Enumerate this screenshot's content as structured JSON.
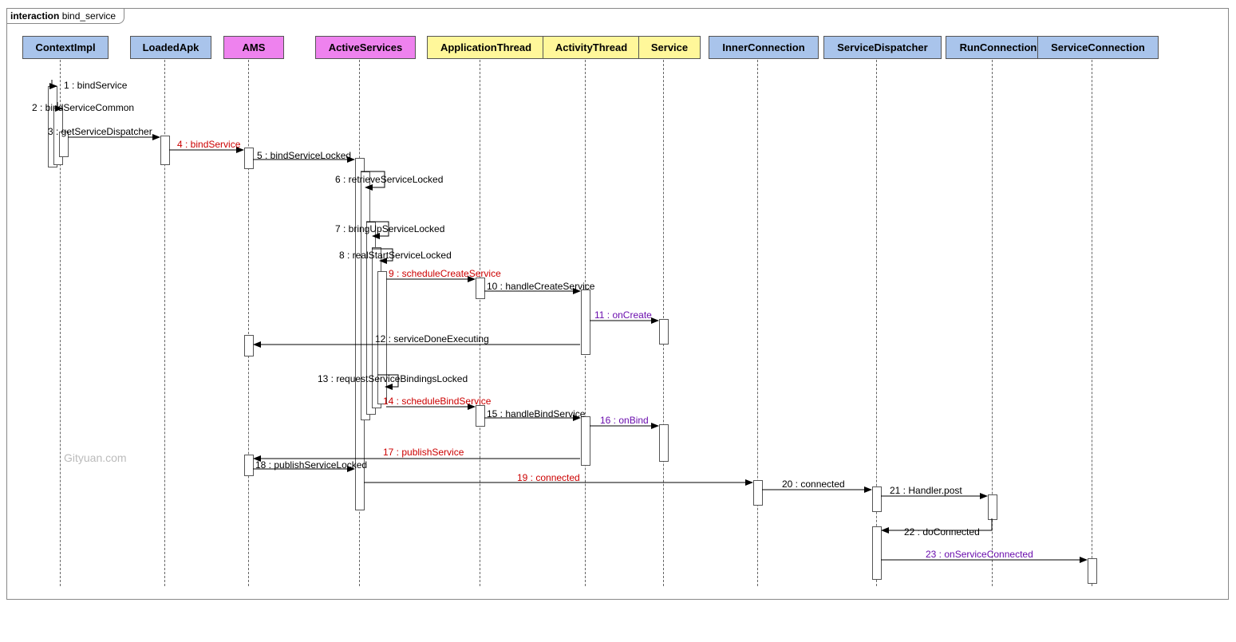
{
  "frame": {
    "label_bold": "interaction",
    "label_title": "bind_service"
  },
  "participants": {
    "ContextImpl": "ContextImpl",
    "LoadedApk": "LoadedApk",
    "AMS": "AMS",
    "ActiveServices": "ActiveServices",
    "ApplicationThread": "ApplicationThread",
    "ActivityThread": "ActivityThread",
    "Service": "Service",
    "InnerConnection": "InnerConnection",
    "ServiceDispatcher": "ServiceDispatcher",
    "RunConnection": "RunConnection",
    "ServiceConnection": "ServiceConnection"
  },
  "messages": {
    "m1": "1 : bindService",
    "m2": "2 : bindServiceCommon",
    "m3": "3 : getServiceDispatcher",
    "m4": "4 : bindService",
    "m5": "5 : bindServiceLocked",
    "m6": "6 : retrieveServiceLocked",
    "m7": "7 : bringUpServiceLocked",
    "m8": "8 : realStartServiceLocked",
    "m9": "9 : scheduleCreateService",
    "m10": "10 : handleCreateService",
    "m11": "11 : onCreate",
    "m12": "12 : serviceDoneExecuting",
    "m13": "13 : requestServiceBindingsLocked",
    "m14": "14 : scheduleBindService",
    "m15": "15 : handleBindService",
    "m16": "16 : onBind",
    "m17": "17 : publishService",
    "m18": "18 : publishServiceLocked",
    "m19": "19 : connected",
    "m20": "20 : connected",
    "m21": "21 : Handler.post",
    "m22": "22 : doConnected",
    "m23": "23 : onServiceConnected"
  },
  "watermark": "Gityuan.com",
  "chart_data": {
    "type": "sequence_diagram",
    "title": "interaction bind_service",
    "participants": [
      {
        "name": "ContextImpl",
        "color": "blue"
      },
      {
        "name": "LoadedApk",
        "color": "blue"
      },
      {
        "name": "AMS",
        "color": "magenta"
      },
      {
        "name": "ActiveServices",
        "color": "magenta"
      },
      {
        "name": "ApplicationThread",
        "color": "yellow"
      },
      {
        "name": "ActivityThread",
        "color": "yellow"
      },
      {
        "name": "Service",
        "color": "yellow"
      },
      {
        "name": "InnerConnection",
        "color": "blue"
      },
      {
        "name": "ServiceDispatcher",
        "color": "blue"
      },
      {
        "name": "RunConnection",
        "color": "blue"
      },
      {
        "name": "ServiceConnection",
        "color": "blue"
      }
    ],
    "messages": [
      {
        "n": 1,
        "from": "ContextImpl",
        "to": "ContextImpl",
        "label": "bindService"
      },
      {
        "n": 2,
        "from": "ContextImpl",
        "to": "ContextImpl",
        "label": "bindServiceCommon"
      },
      {
        "n": 3,
        "from": "ContextImpl",
        "to": "LoadedApk",
        "label": "getServiceDispatcher"
      },
      {
        "n": 4,
        "from": "LoadedApk",
        "to": "AMS",
        "label": "bindService",
        "emph": "red"
      },
      {
        "n": 5,
        "from": "AMS",
        "to": "ActiveServices",
        "label": "bindServiceLocked"
      },
      {
        "n": 6,
        "from": "ActiveServices",
        "to": "ActiveServices",
        "label": "retrieveServiceLocked"
      },
      {
        "n": 7,
        "from": "ActiveServices",
        "to": "ActiveServices",
        "label": "bringUpServiceLocked"
      },
      {
        "n": 8,
        "from": "ActiveServices",
        "to": "ActiveServices",
        "label": "realStartServiceLocked"
      },
      {
        "n": 9,
        "from": "ActiveServices",
        "to": "ApplicationThread",
        "label": "scheduleCreateService",
        "emph": "red"
      },
      {
        "n": 10,
        "from": "ApplicationThread",
        "to": "ActivityThread",
        "label": "handleCreateService"
      },
      {
        "n": 11,
        "from": "ActivityThread",
        "to": "Service",
        "label": "onCreate",
        "emph": "purple"
      },
      {
        "n": 12,
        "from": "ActivityThread",
        "to": "AMS",
        "label": "serviceDoneExecuting"
      },
      {
        "n": 13,
        "from": "ActiveServices",
        "to": "ActiveServices",
        "label": "requestServiceBindingsLocked"
      },
      {
        "n": 14,
        "from": "ActiveServices",
        "to": "ApplicationThread",
        "label": "scheduleBindService",
        "emph": "red"
      },
      {
        "n": 15,
        "from": "ApplicationThread",
        "to": "ActivityThread",
        "label": "handleBindService"
      },
      {
        "n": 16,
        "from": "ActivityThread",
        "to": "Service",
        "label": "onBind",
        "emph": "purple"
      },
      {
        "n": 17,
        "from": "ActivityThread",
        "to": "AMS",
        "label": "publishService",
        "emph": "red"
      },
      {
        "n": 18,
        "from": "AMS",
        "to": "ActiveServices",
        "label": "publishServiceLocked"
      },
      {
        "n": 19,
        "from": "ActiveServices",
        "to": "InnerConnection",
        "label": "connected",
        "emph": "red"
      },
      {
        "n": 20,
        "from": "InnerConnection",
        "to": "ServiceDispatcher",
        "label": "connected"
      },
      {
        "n": 21,
        "from": "ServiceDispatcher",
        "to": "RunConnection",
        "label": "Handler.post"
      },
      {
        "n": 22,
        "from": "RunConnection",
        "to": "ServiceDispatcher",
        "label": "doConnected"
      },
      {
        "n": 23,
        "from": "ServiceDispatcher",
        "to": "ServiceConnection",
        "label": "onServiceConnected",
        "emph": "purple"
      }
    ]
  }
}
